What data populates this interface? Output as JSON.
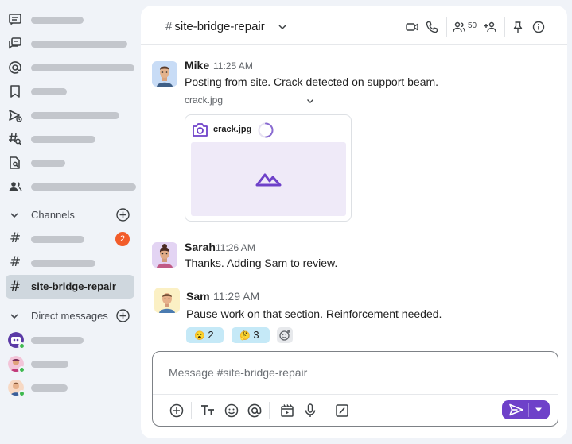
{
  "sidebar": {
    "nav_icons": [
      "threads-icon",
      "chat-bubbles-icon",
      "mentions-icon",
      "bookmark-icon",
      "drafts-sent-icon",
      "search-channels-icon",
      "file-search-icon",
      "people-icon"
    ],
    "channels_label": "Channels",
    "channels": [
      {
        "badge": "2"
      },
      {
        "badge": ""
      },
      {
        "name": "site-bridge-repair"
      }
    ],
    "dm_label": "Direct messages"
  },
  "header": {
    "hash": "#",
    "channel_name": "site-bridge-repair",
    "member_count": "50"
  },
  "messages": [
    {
      "author": "Mike",
      "time": "11:25 AM",
      "text": "Posting from site. Crack detected on support beam.",
      "attachment": {
        "file_name": "crack.jpg",
        "card_name": "crack.jpg"
      }
    },
    {
      "author": "Sarah",
      "time": "11:26 AM",
      "text": "Thanks. Adding Sam to review."
    },
    {
      "author": "Sam",
      "time": "11:29 AM",
      "text": "Pause work on that section. Reinforcement needed.",
      "reactions": [
        {
          "emoji": "😮",
          "count": "2"
        },
        {
          "emoji": "🤔",
          "count": "3"
        }
      ]
    }
  ],
  "composer": {
    "placeholder": "Message #site-bridge-repair"
  },
  "colors": {
    "accent": "#6e41c9",
    "badge": "#f25c2a",
    "online": "#3fb950",
    "reaction_bg": "#c5e9f7",
    "active_channel_bg": "#cfd7de"
  }
}
